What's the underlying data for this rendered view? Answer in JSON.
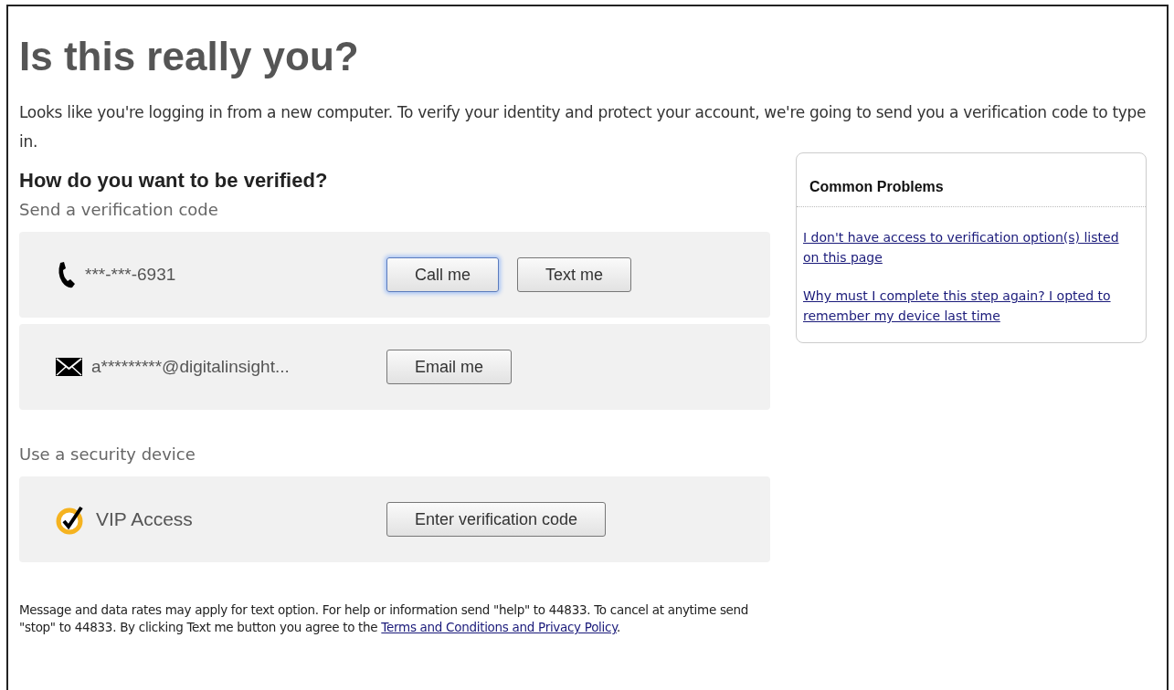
{
  "title": "Is this really you?",
  "intro": "Looks like you're logging in from a new computer. To verify your identity and protect your account, we're going to send you a verification code to type in.",
  "heading": "How do you want to be verified?",
  "sections": [
    {
      "label": "Send a verification code",
      "options": [
        {
          "kind": "phone",
          "text": "***-***-6931",
          "buttons": [
            {
              "label": "Call me",
              "focused": true
            },
            {
              "label": "Text me",
              "focused": false
            }
          ]
        },
        {
          "kind": "email",
          "text": "a*********@digitalinsight...",
          "buttons": [
            {
              "label": "Email me",
              "focused": false
            }
          ]
        }
      ]
    },
    {
      "label": "Use a security device",
      "options": [
        {
          "kind": "vip",
          "text": "VIP Access",
          "buttons": [
            {
              "label": "Enter verification code",
              "focused": false
            }
          ]
        }
      ]
    }
  ],
  "sidebar": {
    "title": "Common Problems",
    "links": [
      "I don't have access to verification option(s) listed on this page",
      "Why must I complete this step again? I opted to remember my device last time"
    ]
  },
  "footer": {
    "text": "Message and data rates may apply for text option. For help or information send \"help\" to 44833. To cancel at anytime send \"stop\" to 44833. By clicking Text me button you agree to the ",
    "link": "Terms and Conditions and Privacy Policy",
    "end": "."
  }
}
